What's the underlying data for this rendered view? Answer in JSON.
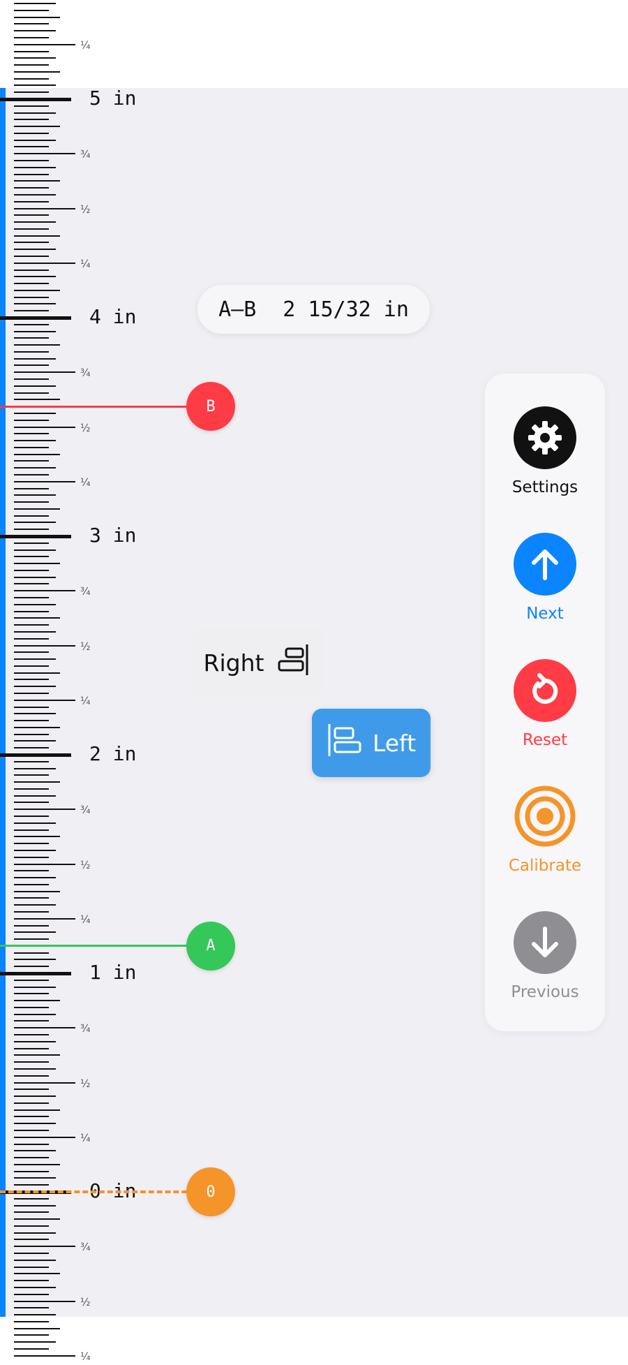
{
  "ruler": {
    "unit": "in",
    "inch_labels": [
      "0 in",
      "1 in",
      "2 in",
      "3 in",
      "4 in",
      "5 in"
    ],
    "fraction_labels": [
      "¼",
      "½",
      "¾"
    ]
  },
  "markers": [
    {
      "id": "zero",
      "label": "0",
      "color": "#f59429",
      "position_in": 0,
      "style": "dashed"
    },
    {
      "id": "a",
      "label": "A",
      "color": "#34c759",
      "position_in": 1.125,
      "style": "solid"
    },
    {
      "id": "b",
      "label": "B",
      "color": "#ff3b45",
      "position_in": 3.594,
      "style": "solid"
    }
  ],
  "measurement": {
    "label": "A–B",
    "value": "2 15/32 in"
  },
  "alignment": {
    "right_label": "Right",
    "left_label": "Left",
    "selected": "left",
    "selected_color": "#3f9bea"
  },
  "controls": [
    {
      "id": "settings",
      "label": "Settings",
      "icon": "gear-icon",
      "color": "#111111",
      "label_color": "#111111"
    },
    {
      "id": "next",
      "label": "Next",
      "icon": "arrow-up-icon",
      "color": "#0a84ff",
      "label_color": "#0a84ff"
    },
    {
      "id": "reset",
      "label": "Reset",
      "icon": "reset-icon",
      "color": "#ff3b45",
      "label_color": "#ff3b45"
    },
    {
      "id": "calibrate",
      "label": "Calibrate",
      "icon": "target-icon",
      "color": "#f59429",
      "label_color": "#f59429"
    },
    {
      "id": "previous",
      "label": "Previous",
      "icon": "arrow-down-icon",
      "color": "#8e8e93",
      "label_color": "#8e8e93"
    }
  ],
  "accent_colors": {
    "edge_bar": "#0a84ff",
    "background": "#f0eff4"
  }
}
